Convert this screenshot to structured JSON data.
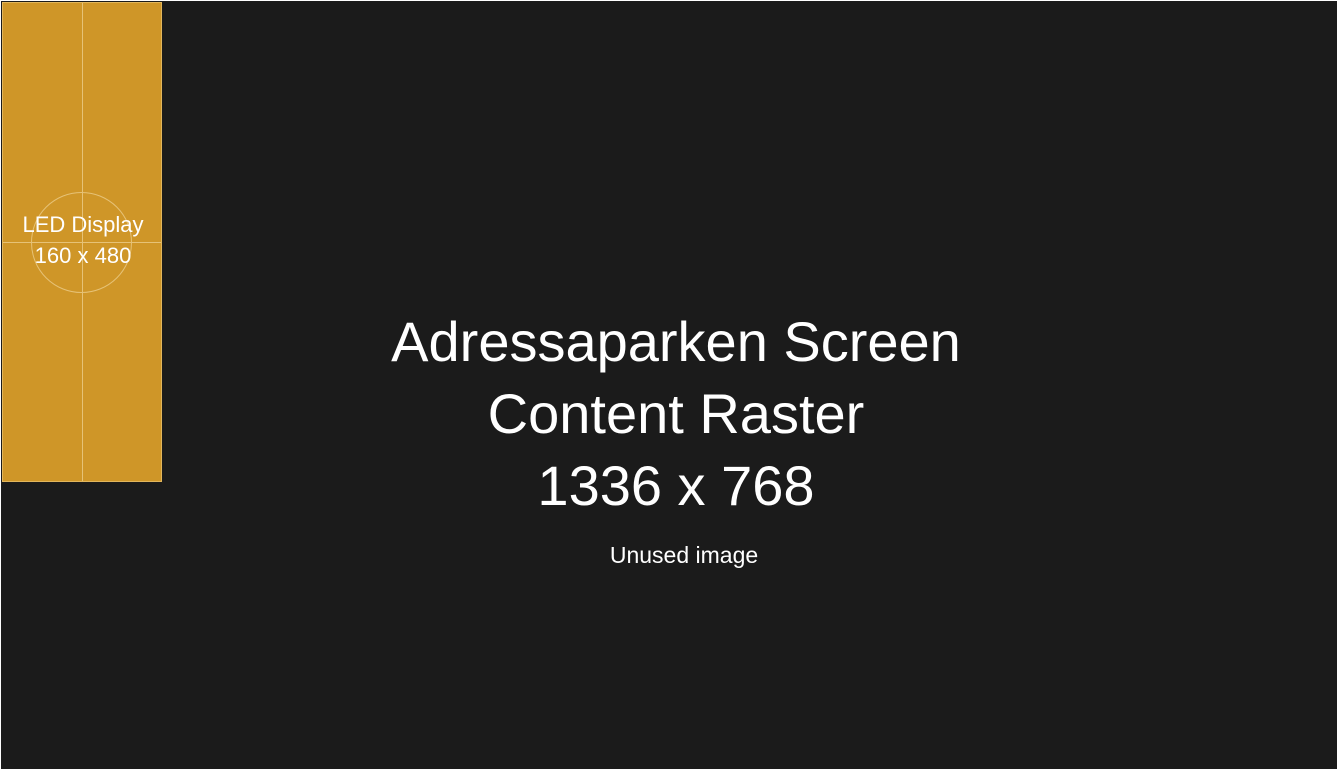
{
  "colors": {
    "background": "#1b1b1b",
    "led_fill": "#cf9628",
    "led_guides": "#e6c277",
    "text": "#ffffff"
  },
  "led_display": {
    "title": "LED Display",
    "size_label": "160 x 480"
  },
  "raster": {
    "title_line1": "Adressaparken Screen",
    "title_line2": "Content Raster",
    "size_label": "1336 x 768",
    "note": "Unused image"
  }
}
